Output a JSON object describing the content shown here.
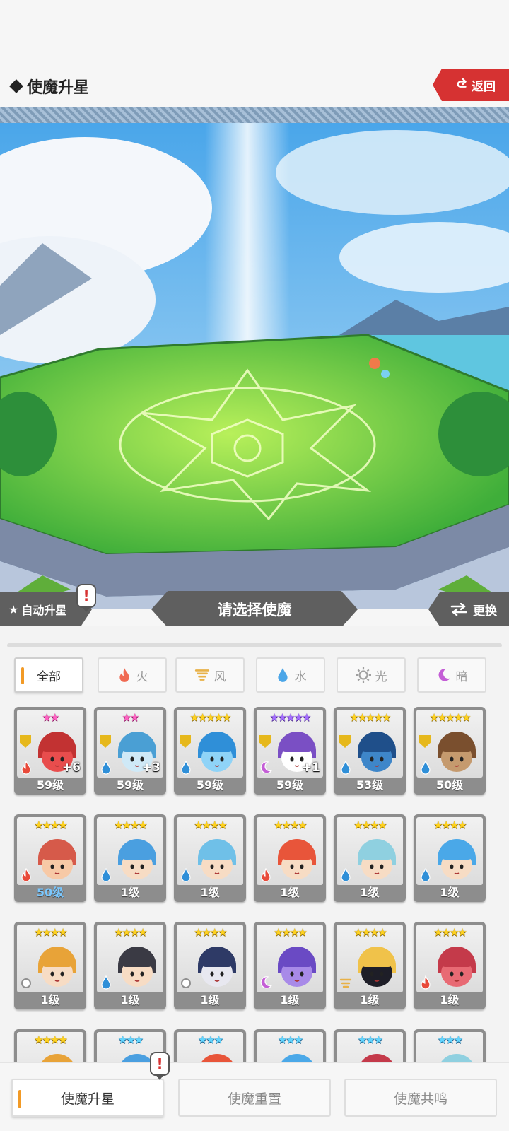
{
  "header": {
    "title": "使魔升星",
    "back_label": "返回"
  },
  "banners": {
    "auto_label": "自动升星",
    "select_label": "请选择使魔",
    "swap_label": "更换",
    "alert_mark": "!"
  },
  "filters": [
    {
      "label": "全部",
      "icon": "none"
    },
    {
      "label": "火",
      "icon": "fire-icon",
      "color": "#f06a52"
    },
    {
      "label": "风",
      "icon": "wind-icon",
      "color": "#e8b148"
    },
    {
      "label": "水",
      "icon": "water-icon",
      "color": "#4ba6e8"
    },
    {
      "label": "光",
      "icon": "light-icon",
      "color": "#a0a0a0"
    },
    {
      "label": "暗",
      "icon": "dark-icon",
      "color": "#c45ed6"
    }
  ],
  "cards": [
    {
      "level": "59级",
      "stars": "★★",
      "star_color": "pink",
      "element": "fire",
      "plus": "+6",
      "shield": true,
      "body": "#e84d4d",
      "hair": "#c23232"
    },
    {
      "level": "59级",
      "stars": "★★",
      "star_color": "pink",
      "element": "water",
      "plus": "+3",
      "shield": true,
      "body": "#cfe9f7",
      "hair": "#4a9fd4"
    },
    {
      "level": "59级",
      "stars": "★★★★★",
      "star_color": "gold",
      "element": "water",
      "plus": "",
      "shield": true,
      "body": "#8fd3f7",
      "hair": "#2f8fd8"
    },
    {
      "level": "59级",
      "stars": "★★★★★",
      "star_color": "purple",
      "element": "dark",
      "plus": "+1",
      "shield": true,
      "body": "#ffffff",
      "hair": "#7a4fc4"
    },
    {
      "level": "53级",
      "stars": "★★★★★",
      "star_color": "gold",
      "element": "water",
      "plus": "",
      "shield": true,
      "body": "#3e86c9",
      "hair": "#1f4f8a"
    },
    {
      "level": "50级",
      "stars": "★★★★★",
      "star_color": "gold",
      "element": "water",
      "plus": "",
      "shield": true,
      "body": "#c59a6e",
      "hair": "#7a4f2e"
    },
    {
      "level": "50级",
      "stars": "★★★★",
      "star_color": "gold",
      "element": "fire",
      "plus": "",
      "shield": false,
      "body": "#f7c9a6",
      "hair": "#d65a4a",
      "level_blue": true
    },
    {
      "level": "1级",
      "stars": "★★★★",
      "star_color": "gold",
      "element": "water",
      "plus": "",
      "shield": false,
      "body": "#f7dcc4",
      "hair": "#4a9fe0"
    },
    {
      "level": "1级",
      "stars": "★★★★",
      "star_color": "gold",
      "element": "water",
      "plus": "",
      "shield": false,
      "body": "#f7dcc4",
      "hair": "#6fc0e8"
    },
    {
      "level": "1级",
      "stars": "★★★★",
      "star_color": "gold",
      "element": "fire",
      "plus": "",
      "shield": false,
      "body": "#f7dcc4",
      "hair": "#e8553a"
    },
    {
      "level": "1级",
      "stars": "★★★★",
      "star_color": "gold",
      "element": "water",
      "plus": "",
      "shield": false,
      "body": "#f7dcc4",
      "hair": "#8fd0e0"
    },
    {
      "level": "1级",
      "stars": "★★★★",
      "star_color": "gold",
      "element": "water",
      "plus": "",
      "shield": false,
      "body": "#f7dcc4",
      "hair": "#4aa8e8"
    },
    {
      "level": "1级",
      "stars": "★★★★",
      "star_color": "gold",
      "element": "light",
      "plus": "",
      "shield": false,
      "body": "#f7dcc4",
      "hair": "#e8a338"
    },
    {
      "level": "1级",
      "stars": "★★★★",
      "star_color": "gold",
      "element": "water",
      "plus": "",
      "shield": false,
      "body": "#f7dcc4",
      "hair": "#3a3a44"
    },
    {
      "level": "1级",
      "stars": "★★★★",
      "star_color": "gold",
      "element": "light",
      "plus": "",
      "shield": false,
      "body": "#e8e8f0",
      "hair": "#2e3a66"
    },
    {
      "level": "1级",
      "stars": "★★★★",
      "star_color": "gold",
      "element": "dark",
      "plus": "",
      "shield": false,
      "body": "#a88ae8",
      "hair": "#6a4ac4"
    },
    {
      "level": "1级",
      "stars": "★★★★",
      "star_color": "gold",
      "element": "wind",
      "plus": "",
      "shield": false,
      "body": "#1e1e28",
      "hair": "#f0c24a"
    },
    {
      "level": "1级",
      "stars": "★★★★",
      "star_color": "gold",
      "element": "fire",
      "plus": "",
      "shield": false,
      "body": "#e86a74",
      "hair": "#c43a4a"
    },
    {
      "level": "",
      "stars": "★★★★",
      "star_color": "gold",
      "element": "none",
      "plus": "",
      "shield": false,
      "body": "#f7dcc4",
      "hair": "#e8a338"
    },
    {
      "level": "",
      "stars": "★★★",
      "star_color": "cyan",
      "element": "none",
      "plus": "",
      "shield": false,
      "body": "#f7dcc4",
      "hair": "#4a9fe0"
    },
    {
      "level": "",
      "stars": "★★★",
      "star_color": "cyan",
      "element": "none",
      "plus": "",
      "shield": false,
      "body": "#f7dcc4",
      "hair": "#e8553a"
    },
    {
      "level": "",
      "stars": "★★★",
      "star_color": "cyan",
      "element": "none",
      "plus": "",
      "shield": false,
      "body": "#f7dcc4",
      "hair": "#4aa8e8"
    },
    {
      "level": "",
      "stars": "★★★",
      "star_color": "cyan",
      "element": "none",
      "plus": "",
      "shield": false,
      "body": "#f7dcc4",
      "hair": "#c43a4a"
    },
    {
      "level": "",
      "stars": "★★★",
      "star_color": "cyan",
      "element": "none",
      "plus": "",
      "shield": false,
      "body": "#f7dcc4",
      "hair": "#8fd0e0"
    }
  ],
  "bottom_tabs": [
    {
      "label": "使魔升星",
      "active": true
    },
    {
      "label": "使魔重置",
      "active": false
    },
    {
      "label": "使魔共鸣",
      "active": false
    }
  ],
  "colors": {
    "accent": "#f29a26",
    "back_red": "#d63232",
    "banner_gray": "#5f5f5f"
  }
}
